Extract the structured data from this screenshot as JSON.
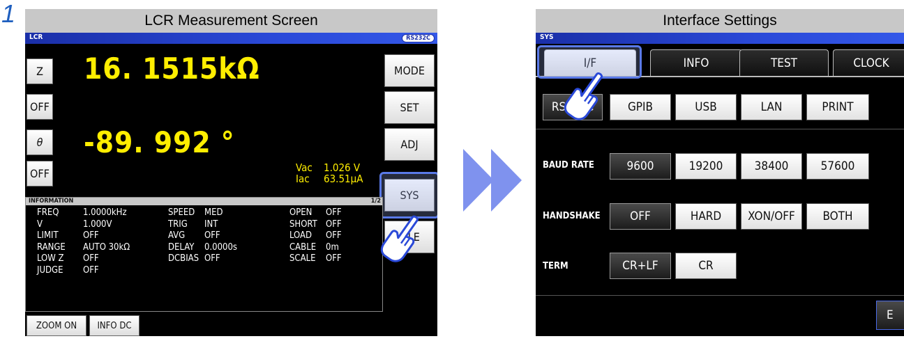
{
  "step": "1",
  "left": {
    "caption": "LCR Measurement Screen",
    "title": "LCR",
    "badge": "RS232C",
    "param1": {
      "button": "Z",
      "value": "16. 1515kΩ"
    },
    "param2": {
      "button": "OFF"
    },
    "param3": {
      "button": "θ",
      "value": "-89. 992 °"
    },
    "param4": {
      "button": "OFF"
    },
    "vac_label": "Vac",
    "vac_value": "1.026 V",
    "iac_label": "Iac",
    "iac_value": "63.51μA",
    "side_buttons": [
      "MODE",
      "SET",
      "ADJ",
      "SYS",
      "FILE"
    ],
    "info_title": "INFORMATION",
    "info_page": "1/2",
    "info_rows": [
      [
        "FREQ",
        "1.0000kHz",
        "SPEED",
        "MED",
        "OPEN",
        "OFF"
      ],
      [
        "V",
        "1.000V",
        "TRIG",
        "INT",
        "SHORT",
        "OFF"
      ],
      [
        "LIMIT",
        "OFF",
        "AVG",
        "OFF",
        "LOAD",
        "OFF"
      ],
      [
        "RANGE",
        "AUTO  30kΩ",
        "DELAY",
        "0.0000s",
        "CABLE",
        "0m"
      ],
      [
        "LOW Z",
        "OFF",
        "DCBIAS",
        "OFF",
        "SCALE",
        "OFF"
      ],
      [
        "JUDGE",
        "OFF",
        "",
        "",
        "",
        ""
      ]
    ],
    "bottom_buttons": [
      "ZOOM ON",
      "INFO DC"
    ]
  },
  "right": {
    "caption": "Interface Settings",
    "title": "SYS",
    "tabs": [
      "I/F",
      "INFO",
      "TEST",
      "CLOCK"
    ],
    "interfaces": [
      "RS232C",
      "GPIB",
      "USB",
      "LAN",
      "PRINT"
    ],
    "baud_label": "BAUD RATE",
    "baud_options": [
      "9600",
      "19200",
      "38400",
      "57600"
    ],
    "handshake_label": "HANDSHAKE",
    "handshake_options": [
      "OFF",
      "HARD",
      "XON/OFF",
      "BOTH"
    ],
    "term_label": "TERM",
    "term_options": [
      "CR+LF",
      "CR"
    ],
    "exit_label": "E"
  },
  "colors": {
    "accent": "#3458e8",
    "highlight": "#5a7ae8",
    "value_yellow": "#ffee00",
    "arrow": "#7f92ee"
  }
}
